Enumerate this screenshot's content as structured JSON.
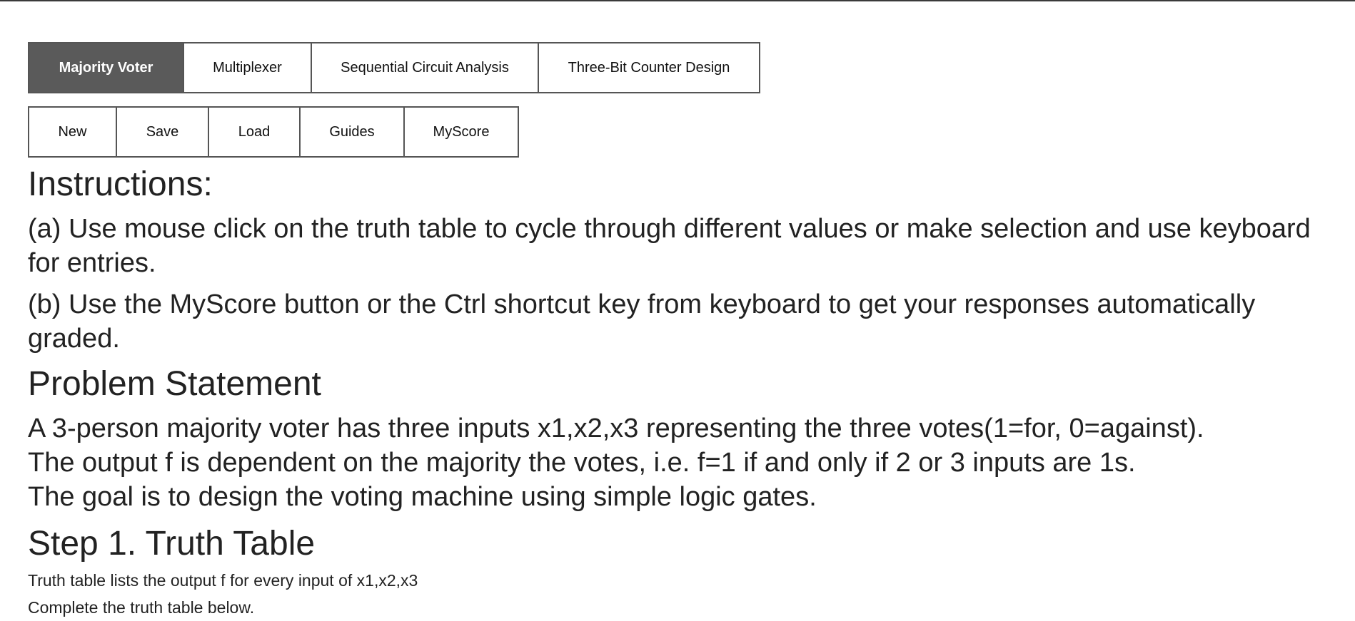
{
  "tabs": [
    {
      "label": "Majority Voter",
      "active": true
    },
    {
      "label": "Multiplexer",
      "active": false
    },
    {
      "label": "Sequential Circuit Analysis",
      "active": false
    },
    {
      "label": "Three-Bit Counter Design",
      "active": false
    }
  ],
  "actions": [
    {
      "label": "New"
    },
    {
      "label": "Save"
    },
    {
      "label": "Load"
    },
    {
      "label": "Guides"
    },
    {
      "label": "MyScore"
    }
  ],
  "instructions": {
    "title": "Instructions:",
    "a": "(a) Use mouse click on the truth table to cycle through different values or make selection and use keyboard for entries.",
    "b": "(b) Use the MyScore button or the Ctrl shortcut key from keyboard to get your responses automatically graded."
  },
  "problem": {
    "title": "Problem Statement",
    "lines": [
      "A 3-person majority voter has three inputs x1,x2,x3 representing the three votes(1=for, 0=against).",
      "The output f is dependent on the majority the votes, i.e. f=1 if and only if 2 or 3 inputs are 1s.",
      "The goal is to design the voting machine using simple logic gates."
    ]
  },
  "step1": {
    "title": "Step 1. Truth Table",
    "desc": "Truth table lists the output f for every input of x1,x2,x3",
    "prompt": "Complete the truth table below."
  },
  "colors": {
    "active_tab_bg": "#5a5a5a",
    "border": "#555555",
    "text": "#222222"
  }
}
